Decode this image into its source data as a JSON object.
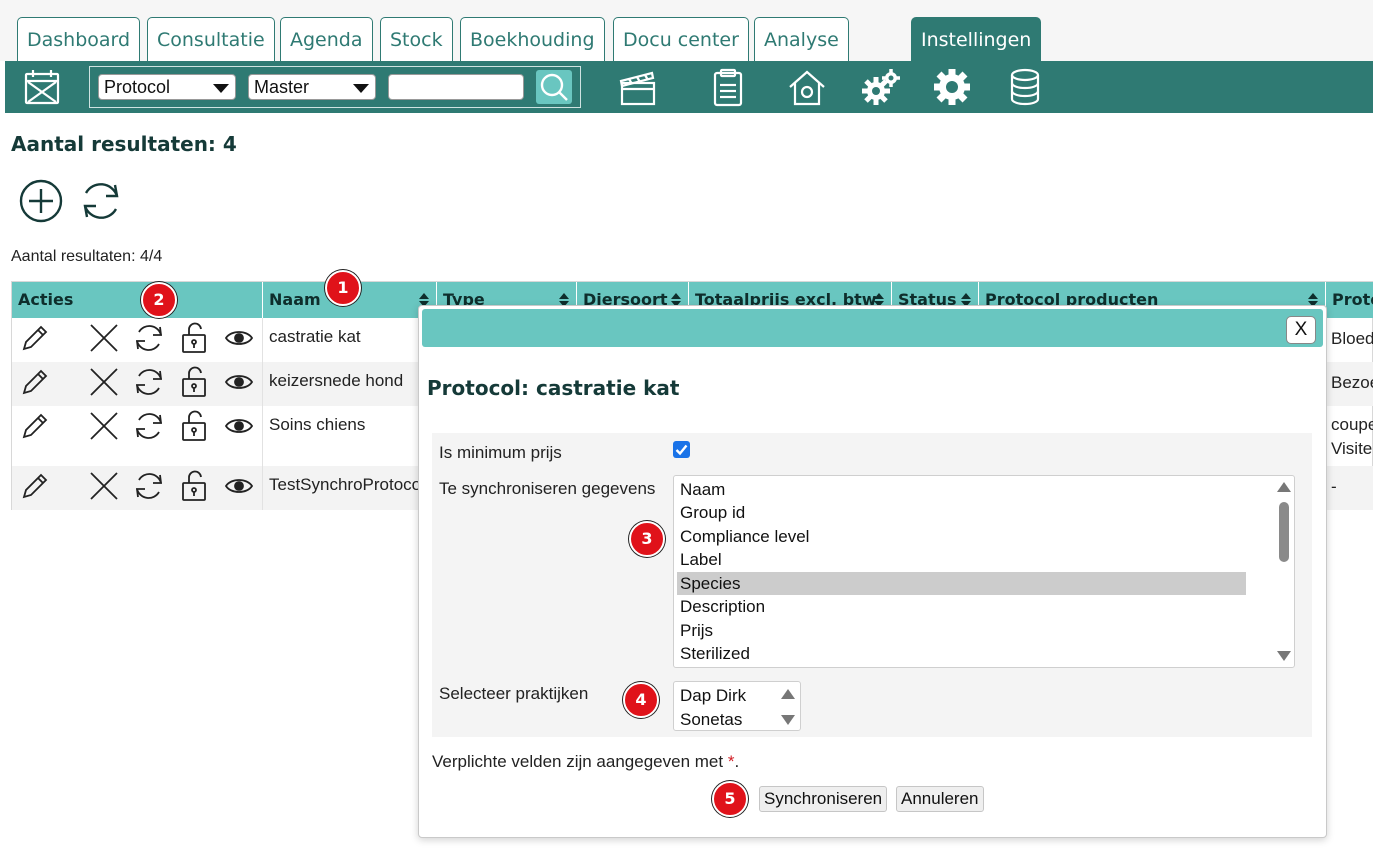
{
  "tabs": [
    {
      "label": "Dashboard",
      "active": false
    },
    {
      "label": "Consultatie",
      "active": false
    },
    {
      "label": "Agenda",
      "active": false
    },
    {
      "label": "Stock",
      "active": false
    },
    {
      "label": "Boekhouding",
      "active": false
    },
    {
      "label": "Docu center",
      "active": false
    },
    {
      "label": "Analyse",
      "active": false
    },
    {
      "label": "Instellingen",
      "active": true
    }
  ],
  "toolbar": {
    "type_select": "Protocol",
    "scope_select": "Master",
    "search_value": "",
    "icons": [
      "calendar-icon",
      "clapperboard-icon",
      "clipboard-icon",
      "house-settings-icon",
      "gears-icon",
      "gear-icon",
      "database-icon"
    ]
  },
  "page": {
    "title": "Aantal resultaten: 4",
    "count_text": "Aantal resultaten: 4/4"
  },
  "table": {
    "headers": [
      "Acties",
      "Naam",
      "Type",
      "Diersoort",
      "Totaalprijs excl. btw",
      "Status",
      "Protocol producten",
      "Proto"
    ],
    "rows": [
      {
        "naam": "castratie kat",
        "extra": [
          "Bloed"
        ]
      },
      {
        "naam": "keizersnede hond",
        "extra": [
          "Bezoe"
        ]
      },
      {
        "naam": "Soins chiens",
        "extra": [
          "coupe",
          "Visite"
        ]
      },
      {
        "naam": "TestSynchroProtocol",
        "extra": [
          "-"
        ]
      }
    ]
  },
  "badges": [
    "1",
    "2",
    "3",
    "4",
    "5"
  ],
  "modal": {
    "close_label": "X",
    "title": "Protocol: castratie kat",
    "min_price_label": "Is minimum prijs",
    "min_price_checked": true,
    "sync_label": "Te synchroniseren gegevens",
    "sync_options": [
      "Naam",
      "Group id",
      "Compliance level",
      "Label",
      "Species",
      "Description",
      "Prijs",
      "Sterilized"
    ],
    "sync_selected": "Species",
    "practices_label": "Selecteer praktijken",
    "practices": [
      "Dap Dirk",
      "Sonetas"
    ],
    "required_note": "Verplichte velden zijn aangegeven met ",
    "required_mark": "*",
    "required_end": ".",
    "sync_button": "Synchroniseren",
    "cancel_button": "Annuleren"
  },
  "colors": {
    "primary": "#2f7a73",
    "header": "#69c6c0",
    "badge": "#e0121a"
  }
}
